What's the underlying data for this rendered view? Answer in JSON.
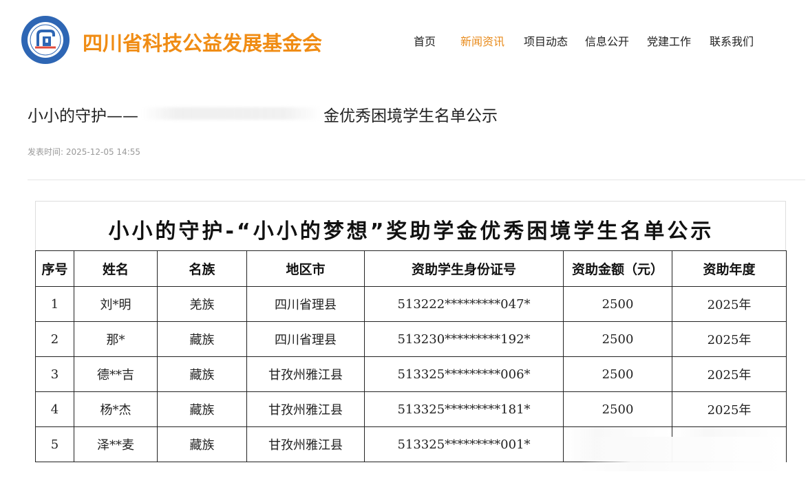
{
  "site": {
    "title": "四川省科技公益发展基金会",
    "logo_icon": "foundation-logo-icon",
    "brand_color": "#f08c14"
  },
  "nav": {
    "items": [
      {
        "label": "首页",
        "active": false
      },
      {
        "label": "新闻资讯",
        "active": true
      },
      {
        "label": "项目动态",
        "active": false
      },
      {
        "label": "信息公开",
        "active": false
      },
      {
        "label": "党建工作",
        "active": false
      },
      {
        "label": "联系我们",
        "active": false
      }
    ],
    "active_color": "#e88a1a"
  },
  "article": {
    "title_prefix": "小小的守护——",
    "title_suffix": "金优秀困境学生名单公示",
    "publish_label": "发表时间:",
    "publish_time": "2025-12-05 14:55"
  },
  "document": {
    "title": "小小的守护-“小小的梦想”奖助学金优秀困境学生名单公示",
    "columns": [
      "序号",
      "姓名",
      "名族",
      "地区市",
      "资助学生身份证号",
      "资助金额（元）",
      "资助年度"
    ],
    "rows": [
      [
        "1",
        "刘*明",
        "羌族",
        "四川省理县",
        "513222*********047*",
        "2500",
        "2025年"
      ],
      [
        "2",
        "那*",
        "藏族",
        "四川省理县",
        "513230*********192*",
        "2500",
        "2025年"
      ],
      [
        "3",
        "德**吉",
        "藏族",
        "甘孜州雅江县",
        "513325*********006*",
        "2500",
        "2025年"
      ],
      [
        "4",
        "杨*杰",
        "藏族",
        "甘孜州雅江县",
        "513325*********181*",
        "2500",
        "2025年"
      ],
      [
        "5",
        "泽**麦",
        "藏族",
        "甘孜州雅江县",
        "513325*********001*",
        "",
        ""
      ]
    ]
  }
}
